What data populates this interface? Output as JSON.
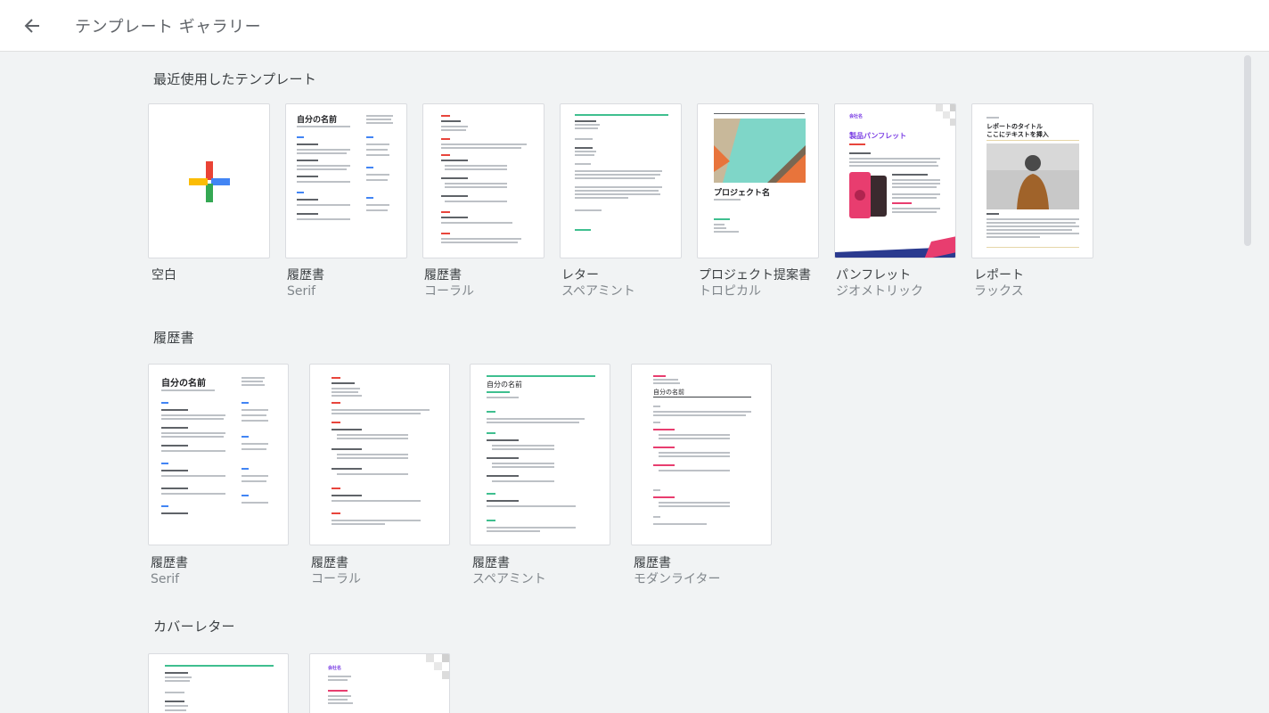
{
  "header": {
    "title": "テンプレート ギャラリー",
    "back_icon": "arrow-back-icon"
  },
  "sections": {
    "recent": {
      "title": "最近使用したテンプレート",
      "items": [
        {
          "name": "空白",
          "sub": ""
        },
        {
          "name": "履歴書",
          "sub": "Serif"
        },
        {
          "name": "履歴書",
          "sub": "コーラル"
        },
        {
          "name": "レター",
          "sub": "スペアミント"
        },
        {
          "name": "プロジェクト提案書",
          "sub": "トロピカル"
        },
        {
          "name": "パンフレット",
          "sub": "ジオメトリック"
        },
        {
          "name": "レポート",
          "sub": "ラックス"
        }
      ]
    },
    "resume": {
      "title": "履歴書",
      "items": [
        {
          "name": "履歴書",
          "sub": "Serif"
        },
        {
          "name": "履歴書",
          "sub": "コーラル"
        },
        {
          "name": "履歴書",
          "sub": "スペアミント"
        },
        {
          "name": "履歴書",
          "sub": "モダンライター"
        }
      ]
    },
    "cover": {
      "title": "カバーレター"
    }
  },
  "thumb_text": {
    "my_name": "自分の名前",
    "project_name": "プロジェクト名",
    "product_pamphlet": "製品パンフレット",
    "company": "会社名",
    "report_title": "レポートのタイトル",
    "report_sub": "ここにテキストを挿入"
  },
  "colors": {
    "coral": "#e8453c",
    "spearmint": "#3fbf8f",
    "pamphlet": "#7b3fe4",
    "accent_blue": "#4285f4"
  }
}
